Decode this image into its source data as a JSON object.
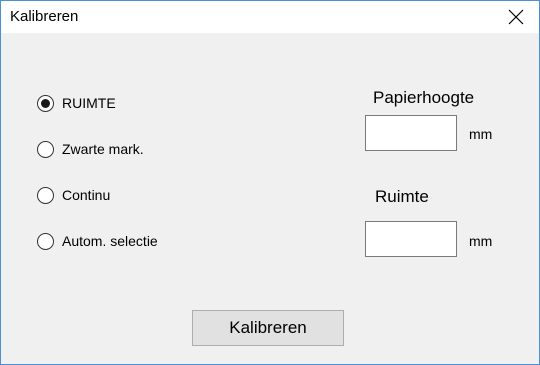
{
  "window": {
    "title": "Kalibreren",
    "close_icon": "close-icon"
  },
  "mode_options": [
    {
      "label": "RUIMTE",
      "selected": true
    },
    {
      "label": "Zwarte mark.",
      "selected": false
    },
    {
      "label": "Continu",
      "selected": false
    },
    {
      "label": "Autom. selectie",
      "selected": false
    }
  ],
  "paper_height": {
    "label": "Papierhoogte",
    "value": "",
    "unit": "mm"
  },
  "gap": {
    "label": "Ruimte",
    "value": "",
    "unit": "mm"
  },
  "calibrate_button": {
    "label": "Kalibreren"
  },
  "colors": {
    "window_border": "#4a90d9",
    "dialog_background": "#f0f0f0",
    "button_background": "#e1e1e1"
  }
}
